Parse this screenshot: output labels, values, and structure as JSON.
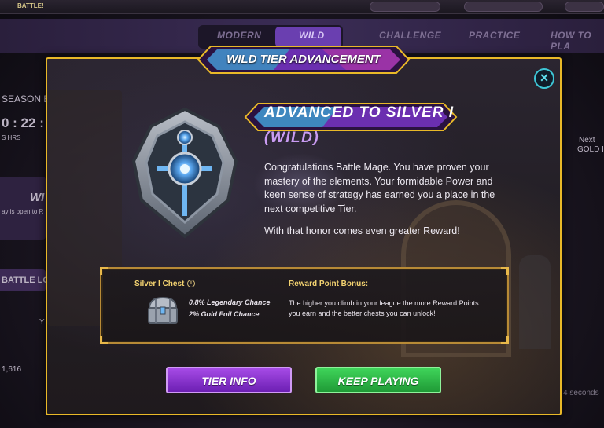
{
  "background": {
    "topbar": {
      "battle_label": "BATTLE!"
    },
    "nav_tabs": [
      "MODERN",
      "WILD",
      "CHALLENGE",
      "PRACTICE",
      "HOW TO PLA"
    ],
    "left_panel": {
      "season_label": "SEASON E",
      "timer": "0 : 22 :",
      "timer_units": "S        HRS",
      "mode_label": "WI",
      "mode_note": "ay is open to R",
      "battle_log": "BATTLE LO",
      "player_initial": "Y",
      "rating": "1,616"
    },
    "right_panel": {
      "next_label": "Next",
      "next_tier": "GOLD I",
      "timer_note": "4 seconds"
    }
  },
  "modal": {
    "banner_title": "WILD TIER ADVANCEMENT",
    "heading": "ADVANCED TO SILVER I",
    "subheading": "(WILD)",
    "paragraph1": "Congratulations Battle Mage. You have proven your mastery of the elements. Your formidable Power and keen sense of strategy has earned you a place in the next competitive Tier.",
    "paragraph2": "With that honor comes even greater Reward!",
    "reward": {
      "chest_title": "Silver I Chest",
      "info_glyph": "i",
      "chance_legendary": "0.8% Legendary Chance",
      "chance_gold_foil": "2% Gold Foil Chance",
      "bonus_title": "Reward Point Bonus:",
      "bonus_text": "The higher you climb in your league the more Reward Points you earn and the better chests you can unlock!"
    },
    "buttons": {
      "tier_info": "TIER INFO",
      "keep_playing": "KEEP PLAYING"
    },
    "close_glyph": "×"
  },
  "colors": {
    "modal_border": "#e9b928",
    "accent_purple": "#c99bf2",
    "close_cyan": "#3ec6d6",
    "gold_text": "#f3d270",
    "tier_button": "#8a35cf",
    "play_button": "#2fb548"
  },
  "icons": [
    "close-icon",
    "info-icon",
    "silver-tier-emblem-icon",
    "silver-chest-icon"
  ]
}
